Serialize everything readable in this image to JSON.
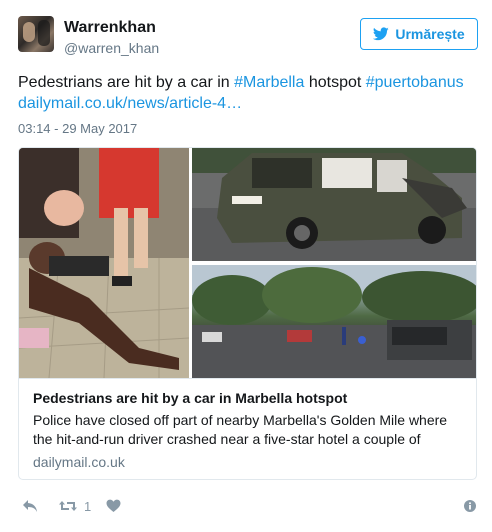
{
  "user": {
    "name": "Warrenkhan",
    "handle": "@warren_khan",
    "follow_label": "Urmărește"
  },
  "tweet": {
    "text_1": "Pedestrians are hit by a car in ",
    "hashtag_1": "#Marbella",
    "text_2": " hotspot ",
    "hashtag_2": "#puertobanus",
    "url": "dailymail.co.uk/news/article-4…",
    "timestamp": "03:14 - 29 May 2017"
  },
  "card": {
    "title": "Pedestrians are hit by a car in Marbella hotspot",
    "description": "Police have closed off part of nearby Marbella's Golden Mile where the hit-and-run driver crashed near a five-star hotel a couple of",
    "domain": "dailymail.co.uk"
  },
  "actions": {
    "retweet_count": "1"
  },
  "colors": {
    "accent": "#1da1f2",
    "link": "#1b95e0",
    "muted": "#657786",
    "icon": "#8899a6",
    "border": "#e1e8ed"
  },
  "icons": [
    "twitter-bird-icon",
    "reply-icon",
    "retweet-icon",
    "like-icon",
    "info-icon"
  ]
}
